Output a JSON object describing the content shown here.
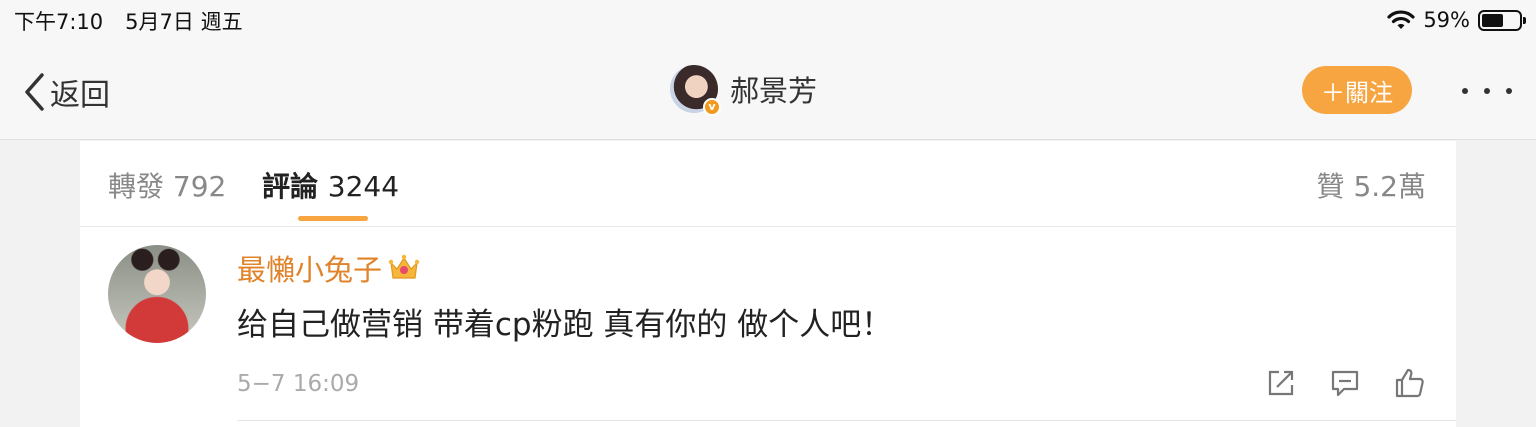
{
  "status_bar": {
    "time": "下午7:10",
    "date": "5月7日 週五",
    "battery_percent": "59%",
    "battery_level": 0.59,
    "wifi_icon": "wifi-icon"
  },
  "nav": {
    "back_label": "返回",
    "title": "郝景芳",
    "follow_label": "＋關注",
    "more_icon": "more-dots-icon",
    "accent_color": "#f7a540"
  },
  "tabs": {
    "repost_label": "轉發",
    "repost_count": "792",
    "comments_label": "評論",
    "comments_count": "3244",
    "likes_label": "贊",
    "likes_count": "5.2萬"
  },
  "comment": {
    "username": "最懶小兔子",
    "badge_icon": "crown-icon",
    "text": "给自己做营销 带着cp粉跑 真有你的 做个人吧！",
    "time": "5−7 16:09",
    "action_icons": [
      "share-icon",
      "reply-icon",
      "like-icon"
    ],
    "username_color": "#e0832a"
  }
}
